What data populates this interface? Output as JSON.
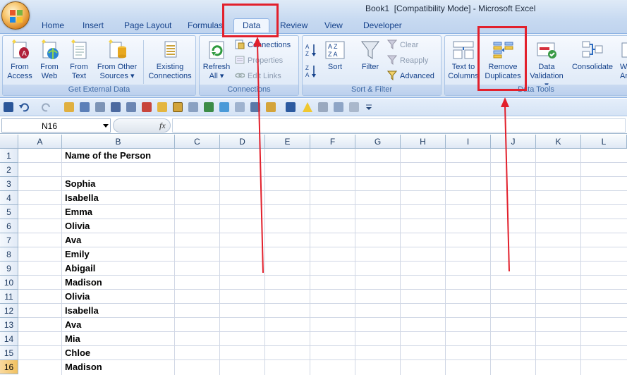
{
  "window": {
    "title": "Book1  [Compatibility Mode] - Microsoft Excel"
  },
  "tabs": [
    {
      "label": "Home"
    },
    {
      "label": "Insert"
    },
    {
      "label": "Page Layout"
    },
    {
      "label": "Formulas"
    },
    {
      "label": "Data",
      "active": true
    },
    {
      "label": "Review"
    },
    {
      "label": "View"
    },
    {
      "label": "Developer"
    }
  ],
  "ribbon": {
    "groups": {
      "get_external_data": {
        "label": "Get External Data",
        "buttons": [
          {
            "line1": "From",
            "line2": "Access",
            "icon": "access-database-icon"
          },
          {
            "line1": "From",
            "line2": "Web",
            "icon": "web-globe-icon"
          },
          {
            "line1": "From",
            "line2": "Text",
            "icon": "text-file-icon"
          },
          {
            "line1": "From Other",
            "line2": "Sources ▾",
            "icon": "other-sources-icon"
          },
          {
            "line1": "Existing",
            "line2": "Connections",
            "icon": "existing-connections-icon"
          }
        ]
      },
      "connections": {
        "label": "Connections",
        "refresh": {
          "line1": "Refresh",
          "line2": "All ▾",
          "icon": "refresh-icon"
        },
        "connections_label": "Connections",
        "properties_label": "Properties",
        "edit_links_label": "Edit Links"
      },
      "sort_filter": {
        "label": "Sort & Filter",
        "sort_label": "Sort",
        "filter_label": "Filter",
        "clear_label": "Clear",
        "reapply_label": "Reapply",
        "advanced_label": "Advanced"
      },
      "data_tools": {
        "label": "Data Tools",
        "text_to_columns": {
          "line1": "Text to",
          "line2": "Columns"
        },
        "remove_duplicates": {
          "line1": "Remove",
          "line2": "Duplicates"
        },
        "data_validation": {
          "line1": "Data",
          "line2": "Validation ▾"
        },
        "consolidate": {
          "line1": "Consolidate"
        },
        "what_if": {
          "line1": "W",
          "line2": "An"
        }
      }
    }
  },
  "formula_bar": {
    "name_box": "N16",
    "fx_label": "fx",
    "formula": ""
  },
  "sheet": {
    "columns": [
      "A",
      "B",
      "C",
      "D",
      "E",
      "F",
      "G",
      "H",
      "I",
      "J",
      "K",
      "L"
    ],
    "rows": [
      "1",
      "2",
      "3",
      "4",
      "5",
      "6",
      "7",
      "8",
      "9",
      "10",
      "11",
      "12",
      "13",
      "14",
      "15",
      "16"
    ],
    "selected_row": "16",
    "column_b": [
      "Name of the Person",
      "",
      "Sophia",
      "Isabella",
      "Emma",
      "Olivia",
      "Ava",
      "Emily",
      "Abigail",
      "Madison",
      "Olivia",
      "Isabella",
      "Ava",
      "Mia",
      "Chloe",
      "Madison"
    ]
  },
  "annotations": {
    "color": "#e2202c"
  }
}
